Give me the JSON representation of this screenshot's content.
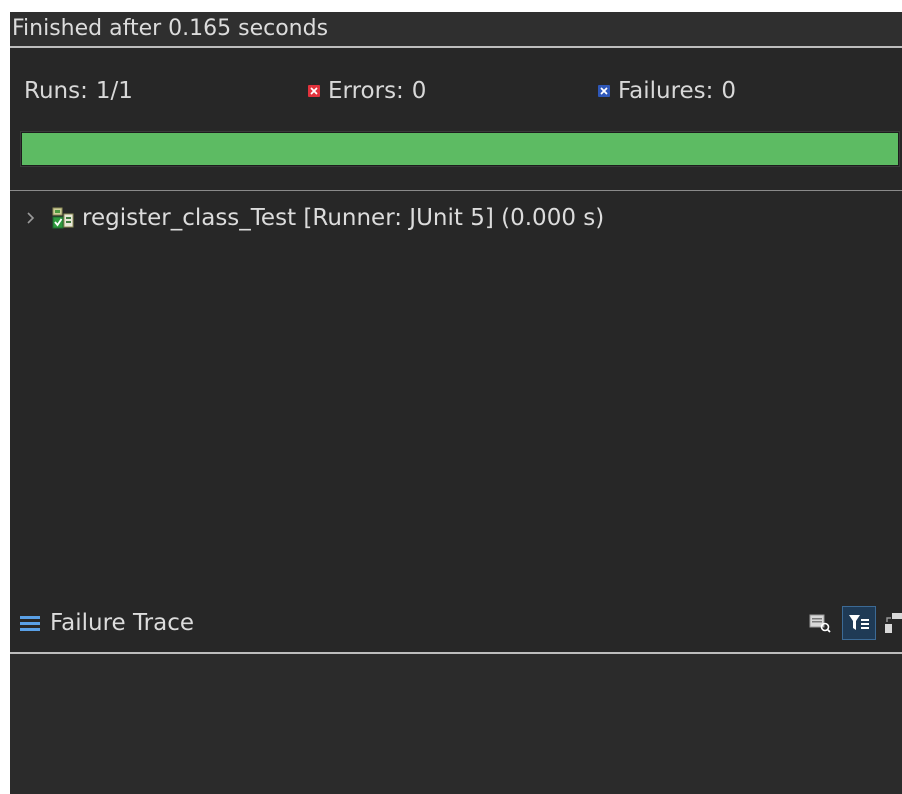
{
  "status": {
    "text": "Finished after 0.165 seconds"
  },
  "counters": {
    "runs_label": "Runs:",
    "runs_value": "1/1",
    "errors_label": "Errors:",
    "errors_value": "0",
    "failures_label": "Failures:",
    "failures_value": "0"
  },
  "progress": {
    "fraction": 1.0,
    "color": "#5dbb63"
  },
  "tree": {
    "items": [
      {
        "label": "register_class_Test [Runner: JUnit 5] (0.000 s)",
        "icon": "test-suite-passed-icon",
        "expanded": false
      }
    ]
  },
  "trace": {
    "title": "Failure Trace",
    "icons": [
      "compare-results-icon",
      "filter-stack-trace-icon",
      "copy-trace-icon"
    ]
  },
  "colors": {
    "error": "#e2323c",
    "failure": "#2e57b8",
    "accent": "#5aa0e6"
  }
}
